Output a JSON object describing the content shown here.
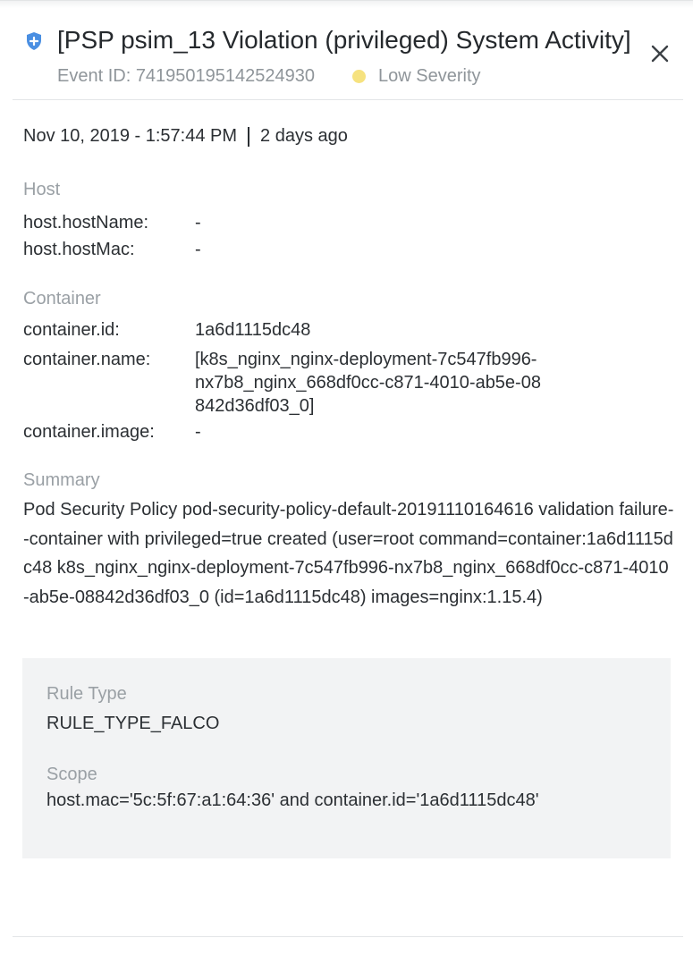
{
  "header": {
    "title": "[PSP psim_13 Violation (privileged) System Activity]",
    "event_id": "Event ID: 741950195142524930",
    "severity": "Low Severity",
    "severity_color": "#f6e27f",
    "shield_icon": "shield-icon",
    "close_icon": "close-icon"
  },
  "time": {
    "date": "Nov 10, 2019 - 1:57:44 PM",
    "relative": "2 days ago"
  },
  "host": {
    "title": "Host",
    "fields": [
      {
        "key": "host.hostName:",
        "value": "-"
      },
      {
        "key": "host.hostMac:",
        "value": "-"
      }
    ]
  },
  "container": {
    "title": "Container",
    "fields": [
      {
        "key": "container.id:",
        "value": "1a6d1115dc48"
      },
      {
        "key": "container.name:",
        "value": "[k8s_nginx_nginx-deployment-7c547fb996-nx7b8_nginx_668df0cc-c871-4010-ab5e-08842d36df03_0]"
      },
      {
        "key": "container.image:",
        "value": "-"
      }
    ]
  },
  "summary": {
    "title": "Summary",
    "text": "Pod Security Policy pod-security-policy-default-20191110164616 validation failure--container with privileged=true created (user=root command=container:1a6d1115dc48 k8s_nginx_nginx-deployment-7c547fb996-nx7b8_nginx_668df0cc-c871-4010-ab5e-08842d36df03_0 (id=1a6d1115dc48) images=nginx:1.15.4)"
  },
  "rule": {
    "type_label": "Rule Type",
    "type_value": "RULE_TYPE_FALCO",
    "scope_label": "Scope",
    "scope_value": "host.mac='5c:5f:67:a1:64:36' and container.id='1a6d1115dc48'"
  }
}
